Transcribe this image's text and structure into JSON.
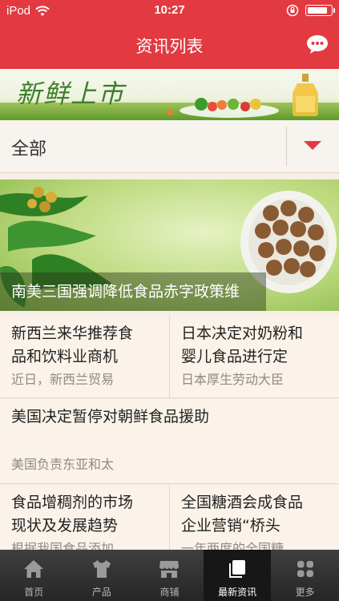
{
  "status_bar": {
    "carrier": "iPod",
    "time": "10:27",
    "battery_level": 0.9
  },
  "nav": {
    "title": "资讯列表",
    "chat_icon": "chat-bubble-icon"
  },
  "banner": {
    "logo_text": "新鲜上市",
    "active_dot_color": "#e77f2f"
  },
  "category": {
    "selected": "全部"
  },
  "feature": {
    "caption": "南美三国强调降低食品赤字政策维"
  },
  "news": [
    {
      "title": "新西兰来华推荐食品和饮料业商机",
      "title_l1": "新西兰来华推荐食",
      "title_l2": "品和饮料业商机",
      "summary": "近日，新西兰贸易"
    },
    {
      "title": "日本决定对奶粉和婴儿食品进行定",
      "title_l1": "日本决定对奶粉和",
      "title_l2": "婴儿食品进行定",
      "summary": "日本厚生劳动大臣"
    },
    {
      "title": "美国决定暂停对朝鲜食品援助",
      "summary": "美国负责东亚和太"
    },
    {
      "title": "食品增稠剂的市场现状及发展趋势",
      "title_l1": "食品增稠剂的市场",
      "title_l2": "现状及发展趋势",
      "summary": "根据我国食品添加"
    },
    {
      "title": "全国糖酒会成食品企业营销“桥头",
      "title_l1": "全国糖酒会成食品",
      "title_l2": "企业营销“桥头",
      "summary": "一年两度的全国糖"
    }
  ],
  "tabs": [
    {
      "label": "首页",
      "icon": "home-icon",
      "active": false
    },
    {
      "label": "产品",
      "icon": "shirt-icon",
      "active": false
    },
    {
      "label": "商铺",
      "icon": "store-icon",
      "active": false
    },
    {
      "label": "最新资讯",
      "icon": "news-icon",
      "active": true
    },
    {
      "label": "更多",
      "icon": "more-grid-icon",
      "active": false
    }
  ],
  "colors": {
    "brand_red": "#e23a40",
    "background": "#f7eee6",
    "tabbar": "#2e2e2e"
  }
}
